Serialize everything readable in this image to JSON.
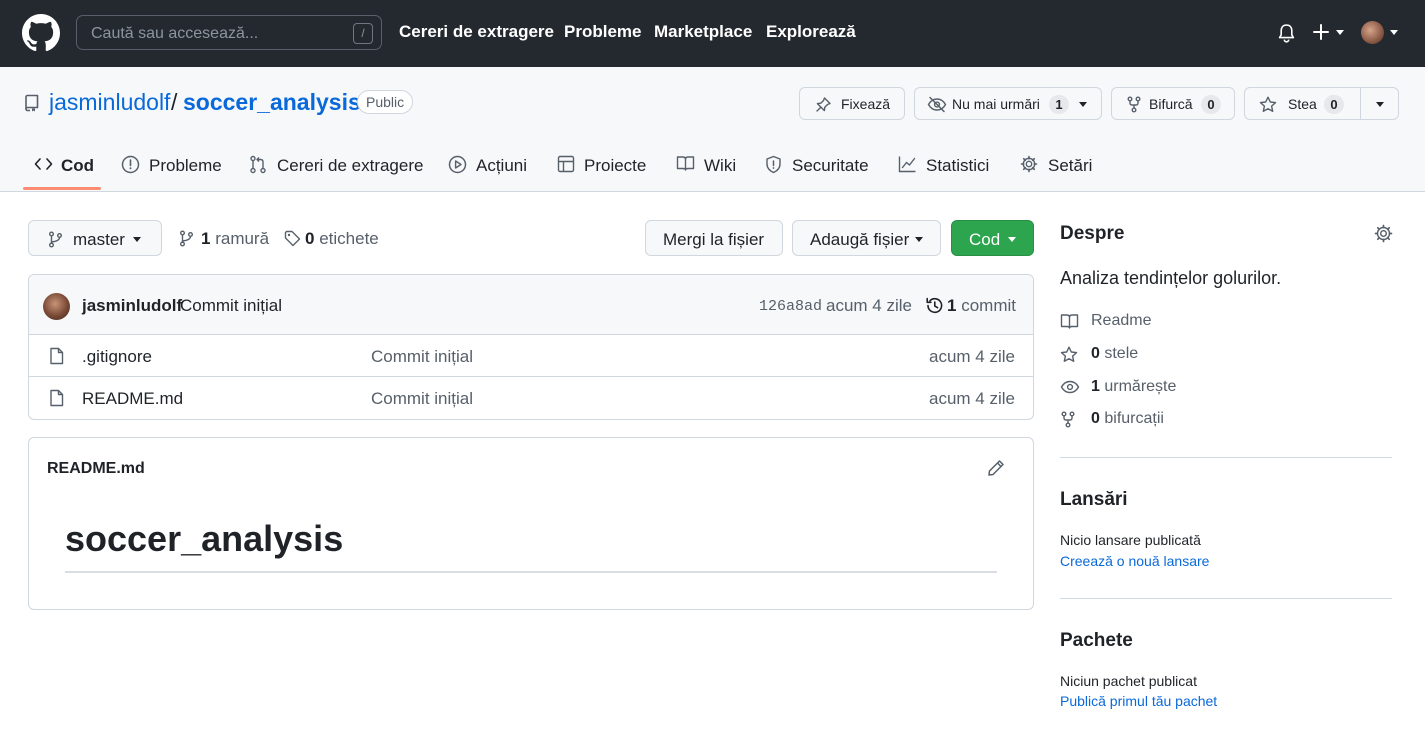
{
  "topbar": {
    "search_placeholder": "Caută sau accesează...",
    "search_shortcut": "/",
    "nav": [
      "Cereri de extragere",
      "Probleme",
      "Marketplace",
      "Explorează"
    ]
  },
  "repo": {
    "owner": "jasminludolf",
    "separator": "/",
    "name": "soccer_analysis",
    "visibility": "Public",
    "actions": {
      "pin": "Fixează",
      "unwatch": "Nu mai urmări",
      "watch_count": "1",
      "fork": "Bifurcă",
      "fork_count": "0",
      "star": "Stea",
      "star_count": "0"
    },
    "tabs": [
      "Cod",
      "Probleme",
      "Cereri de extragere",
      "Acțiuni",
      "Proiecte",
      "Wiki",
      "Securitate",
      "Statistici",
      "Setări"
    ],
    "active_tab": "Cod"
  },
  "toolbar": {
    "branch": "master",
    "branches_count": "1",
    "branches_label": "ramură",
    "tags_count": "0",
    "tags_label": "etichete",
    "go_to_file": "Mergi la fișier",
    "add_file": "Adaugă fișier",
    "code": "Cod"
  },
  "commit": {
    "author": "jasminludolf",
    "message": "Commit inițial",
    "hash": "126a8ad",
    "time": "acum 4 zile",
    "count": "1",
    "count_label": "commit"
  },
  "files": [
    {
      "name": ".gitignore",
      "message": "Commit inițial",
      "time": "acum 4 zile"
    },
    {
      "name": "README.md",
      "message": "Commit inițial",
      "time": "acum 4 zile"
    }
  ],
  "readme": {
    "filename": "README.md",
    "heading": "soccer_analysis"
  },
  "sidebar": {
    "about_title": "Despre",
    "description": "Analiza tendințelor golurilor.",
    "readme": "Readme",
    "stars_count": "0",
    "stars_label": "stele",
    "watching_count": "1",
    "watching_label": "urmărește",
    "forks_count": "0",
    "forks_label": "bifurcații",
    "releases_title": "Lansări",
    "no_releases": "Nicio lansare publicată",
    "create_release": "Creează o nouă lansare",
    "packages_title": "Pachete",
    "no_packages": "Niciun pachet publicat",
    "publish_package": "Publică primul tău pachet"
  },
  "colors": {
    "header_bg": "#24292f",
    "link": "#0969da",
    "code_button": "#2da44e",
    "active_tab_underline": "#fd8c73"
  }
}
